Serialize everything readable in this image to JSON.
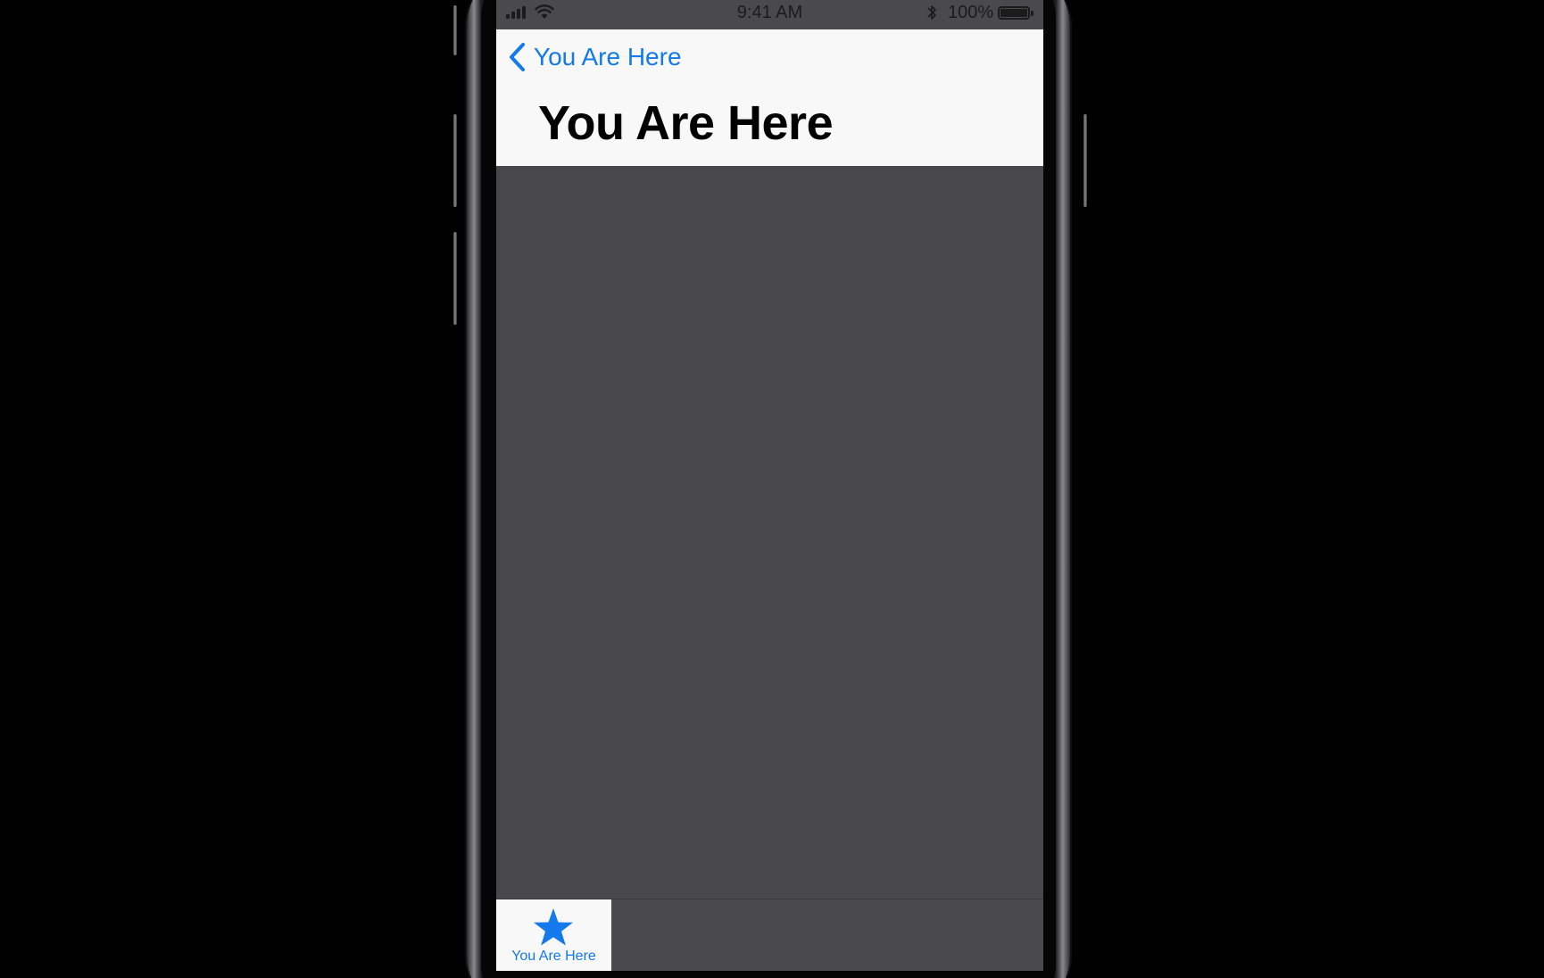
{
  "status_bar": {
    "time": "9:41 AM",
    "battery_percent": "100%"
  },
  "nav_bar": {
    "back_label": "You Are Here",
    "title": "You Are Here"
  },
  "tab_bar": {
    "items": [
      {
        "label": "You Are Here",
        "icon": "star-icon",
        "selected": true
      }
    ]
  },
  "colors": {
    "accent": "#1479ea",
    "content_background": "#48484c",
    "bar_background": "#f8f8f8"
  }
}
